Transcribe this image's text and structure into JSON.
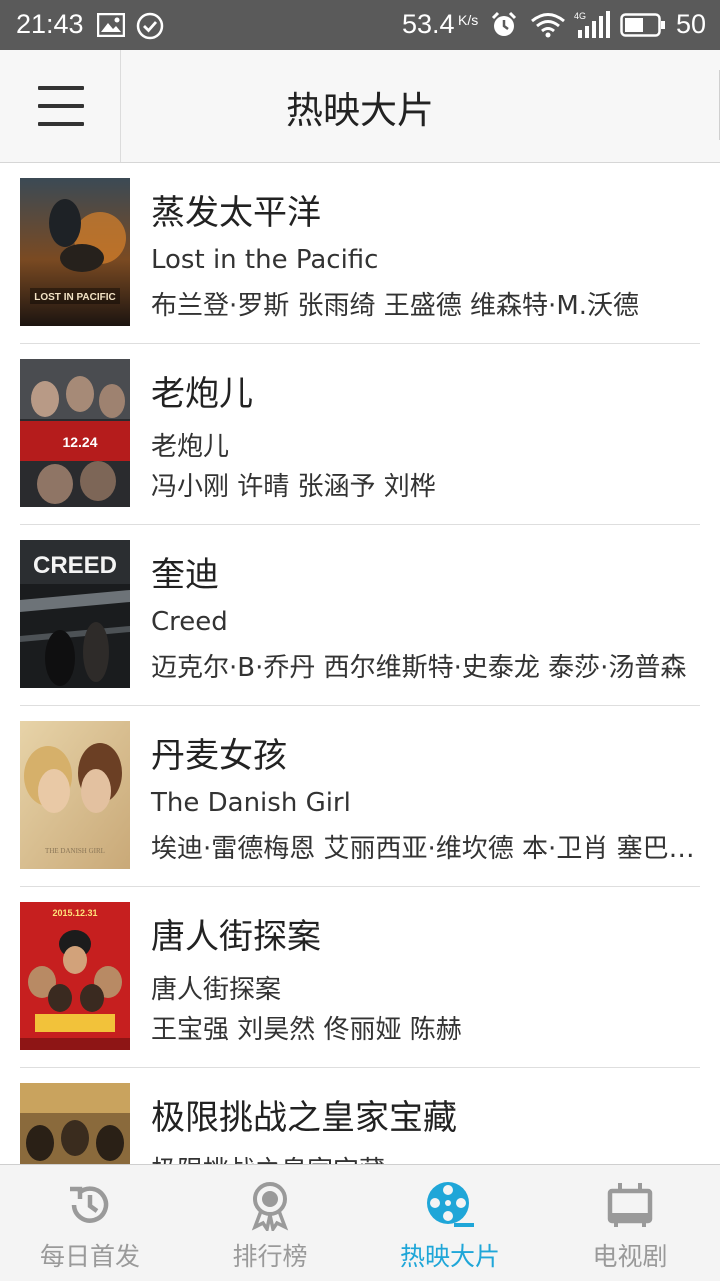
{
  "status_bar": {
    "time": "21:43",
    "speed": "53.4",
    "speed_unit": "K/s",
    "network": "4G",
    "battery": "50"
  },
  "header": {
    "title": "热映大片",
    "menu_icon": "hamburger-menu-icon"
  },
  "movies": [
    {
      "title": "蒸发太平洋",
      "subtitle": "Lost in the Pacific",
      "cast": "布兰登·罗斯 张雨绮 王盛德 维森特·M.沃德",
      "poster_label": "LOST IN PACIFIC"
    },
    {
      "title": "老炮儿",
      "subtitle": "老炮儿",
      "cast": "冯小刚 许晴 张涵予 刘桦",
      "poster_label": "12.24"
    },
    {
      "title": "奎迪",
      "subtitle": "Creed",
      "cast": "迈克尔·B·乔丹 西尔维斯特·史泰龙 泰莎·汤普森",
      "poster_label": "CREED"
    },
    {
      "title": "丹麦女孩",
      "subtitle": "The Danish Girl",
      "cast": "埃迪·雷德梅恩 艾丽西亚·维坎德 本·卫肖 塞巴斯蒂安·科赫",
      "poster_label": "THE DANISH GIRL"
    },
    {
      "title": "唐人街探案",
      "subtitle": "唐人街探案",
      "cast": "王宝强 刘昊然 佟丽娅 陈赫",
      "poster_label": "2015.12.31"
    },
    {
      "title": "极限挑战之皇家宝藏",
      "subtitle": "极限挑战之皇家宝藏",
      "cast": "",
      "poster_label": ""
    }
  ],
  "tabs": [
    {
      "label": "每日首发",
      "icon": "history-icon",
      "active": false
    },
    {
      "label": "排行榜",
      "icon": "medal-icon",
      "active": false
    },
    {
      "label": "热映大片",
      "icon": "film-reel-icon",
      "active": true
    },
    {
      "label": "电视剧",
      "icon": "tv-icon",
      "active": false
    }
  ],
  "colors": {
    "active_tab": "#1fa6d8",
    "inactive_tab": "#9a9a9a",
    "status_bar": "#5a5a5a"
  }
}
